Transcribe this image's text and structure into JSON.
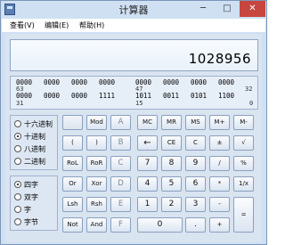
{
  "window": {
    "title": "计算器",
    "icon": "calculator-icon"
  },
  "window_buttons": {
    "minimize": "─",
    "maximize": "□",
    "close": "✕"
  },
  "menu": [
    {
      "label": "查看(V)"
    },
    {
      "label": "编辑(E)"
    },
    {
      "label": "帮助(H)"
    }
  ],
  "display": {
    "value": "1028956"
  },
  "bits": {
    "row1_bits": [
      "0000",
      "0000",
      "0000",
      "0000",
      "0000",
      "0000",
      "0000",
      "0000"
    ],
    "row1_positions": [
      "63",
      "47",
      "32"
    ],
    "row2_bits": [
      "0000",
      "0000",
      "0000",
      "1111",
      "1011",
      "0011",
      "0101",
      "1100"
    ],
    "row2_positions": [
      "31",
      "15",
      "0"
    ]
  },
  "radix": {
    "options": [
      "十六进制",
      "十进制",
      "八进制",
      "二进制"
    ],
    "selected": "十进制"
  },
  "word_size": {
    "options": [
      "四字",
      "双字",
      "字",
      "字节"
    ],
    "selected": "四字"
  },
  "buttons": {
    "mod": "Mod",
    "A": "A",
    "MC": "MC",
    "MR": "MR",
    "MS": "MS",
    "Mplus": "M+",
    "Mminus": "M-",
    "lparen": "(",
    "rparen": ")",
    "B": "B",
    "backspace": "←",
    "CE": "CE",
    "C": "C",
    "plusminus": "±",
    "sqrt": "√",
    "RoL": "RoL",
    "RoR": "RoR",
    "Cbtn": "C",
    "d7": "7",
    "d8": "8",
    "d9": "9",
    "div": "/",
    "pct": "%",
    "Or": "Or",
    "Xor": "Xor",
    "D": "D",
    "d4": "4",
    "d5": "5",
    "d6": "6",
    "mul": "*",
    "recip": "1/x",
    "Lsh": "Lsh",
    "Rsh": "Rsh",
    "E": "E",
    "d1": "1",
    "d2": "2",
    "d3": "3",
    "sub": "-",
    "eq": "=",
    "Not": "Not",
    "And": "And",
    "F": "F",
    "d0": "0",
    "dot": ".",
    "add": "+"
  }
}
